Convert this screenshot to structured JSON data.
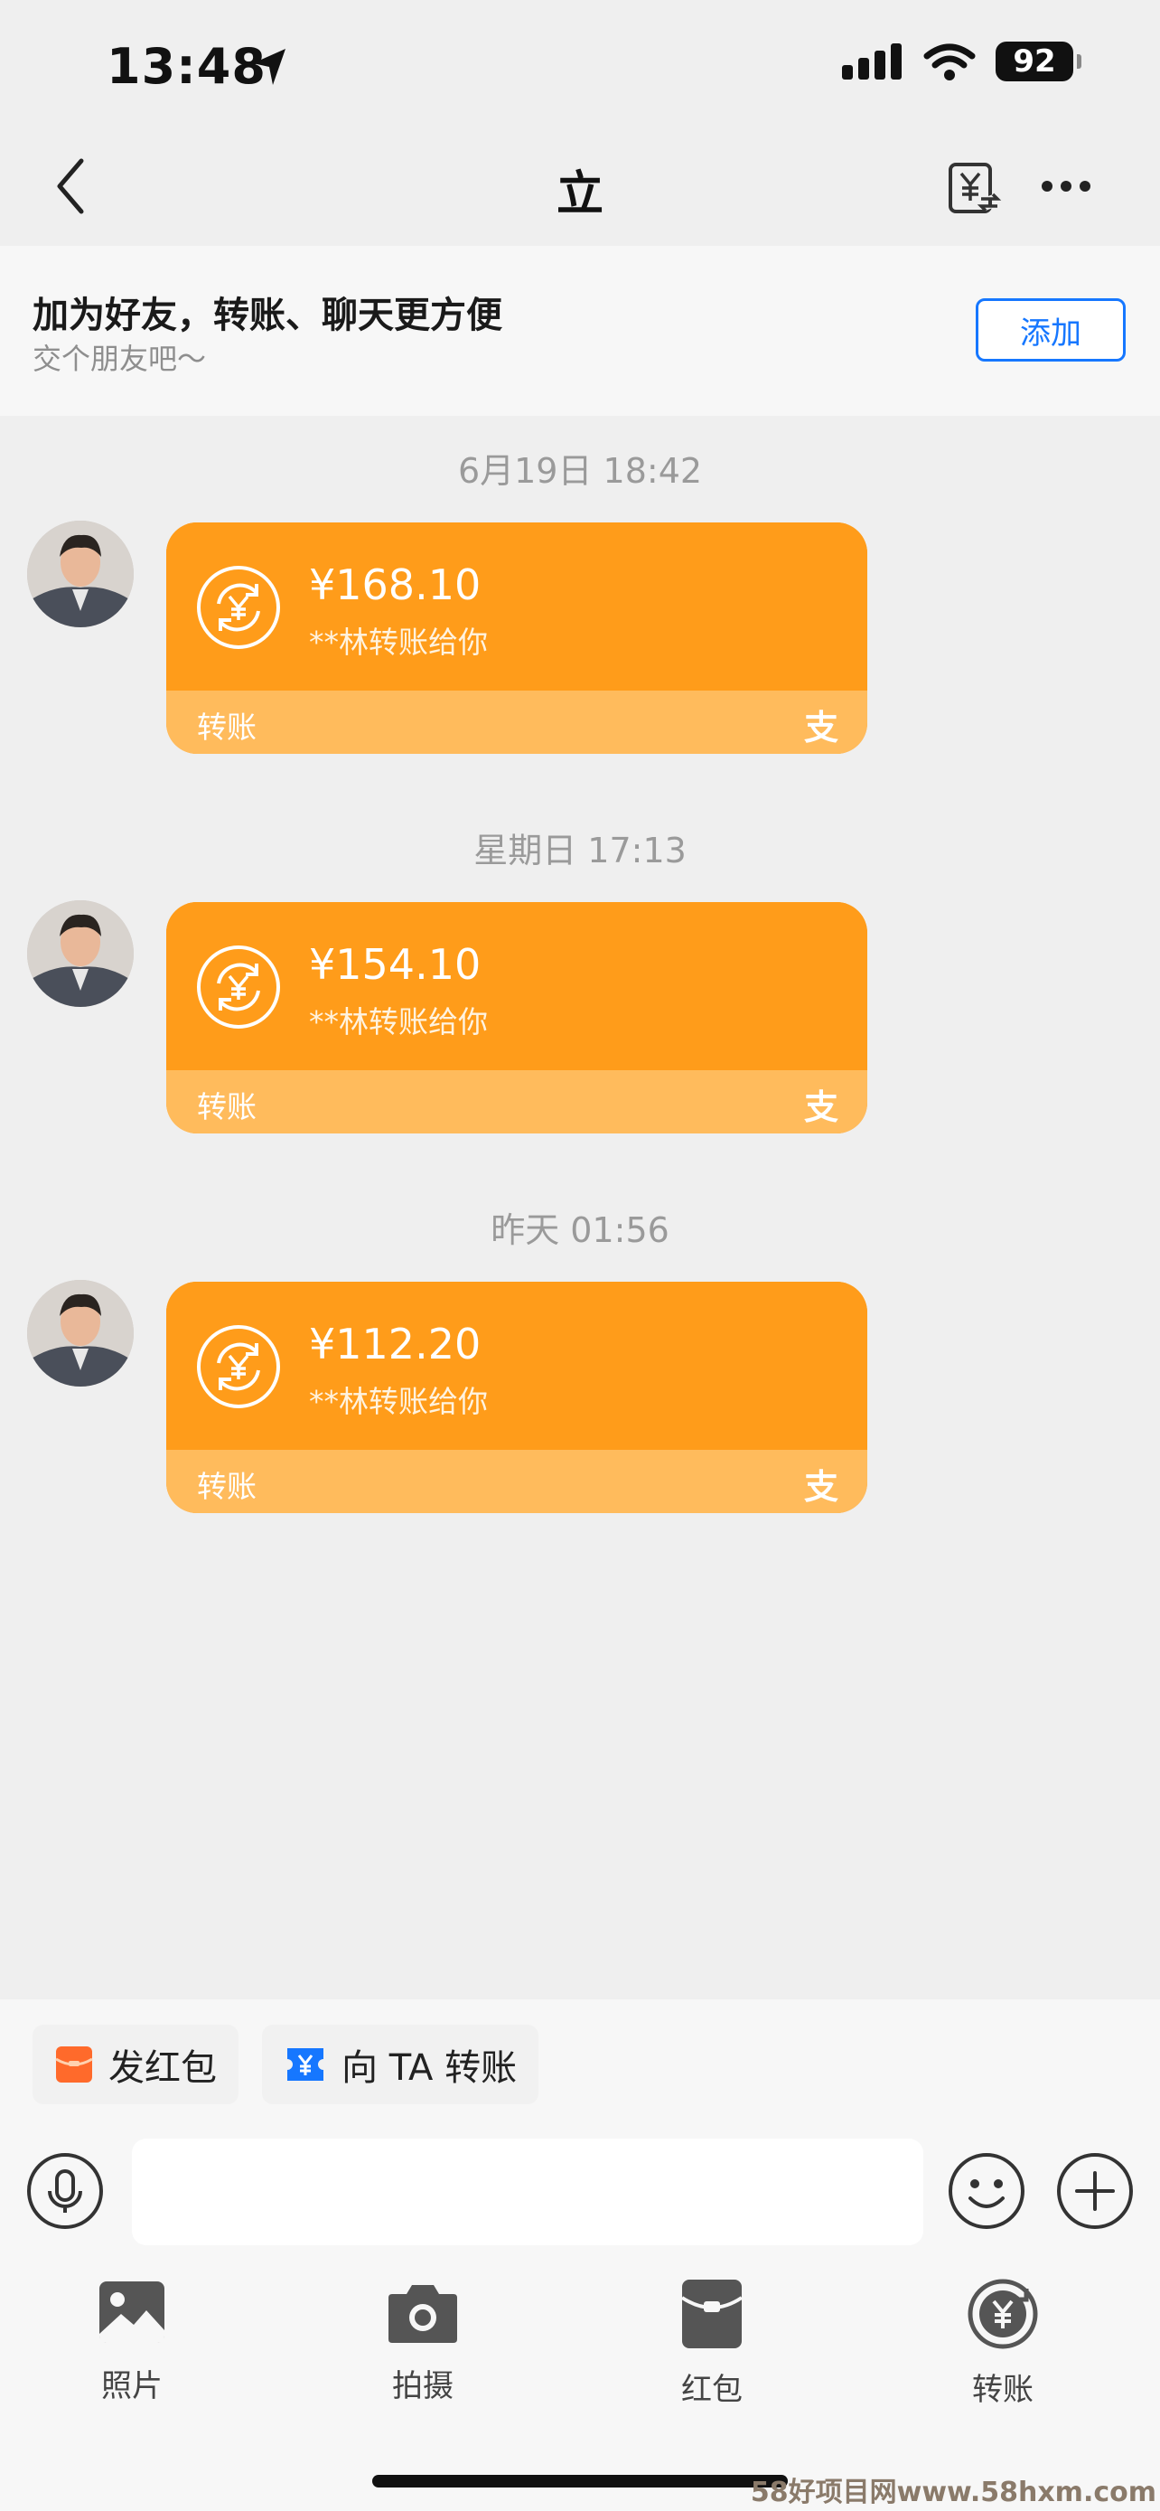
{
  "status": {
    "time": "13:48",
    "battery": "92"
  },
  "nav": {
    "title": "立"
  },
  "banner": {
    "title": "加为好友，转账、聊天更方便",
    "subtitle": "交个朋友吧～",
    "add_label": "添加"
  },
  "messages": [
    {
      "timestamp": "6月19日 18:42",
      "amount": "¥168.10",
      "desc": "**林转账给你",
      "label": "转账",
      "logo": "支"
    },
    {
      "timestamp": "星期日 17:13",
      "amount": "¥154.10",
      "desc": "**林转账给你",
      "label": "转账",
      "logo": "支"
    },
    {
      "timestamp": "昨天 01:56",
      "amount": "¥112.20",
      "desc": "**林转账给你",
      "label": "转账",
      "logo": "支"
    }
  ],
  "quick_actions": [
    {
      "label": "发红包",
      "icon": "red-envelope-icon"
    },
    {
      "label": "向 TA 转账",
      "icon": "transfer-ticket-icon"
    }
  ],
  "input": {
    "placeholder": ""
  },
  "tools": [
    {
      "label": "照片",
      "icon": "photo-icon"
    },
    {
      "label": "拍摄",
      "icon": "camera-icon"
    },
    {
      "label": "红包",
      "icon": "red-packet-icon"
    },
    {
      "label": "转账",
      "icon": "transfer-icon"
    }
  ],
  "watermark": "58好项目网www.58hxm.com",
  "colors": {
    "card": "#ff9c1a",
    "card_bottom": "#ffbb5c",
    "accent": "#1677ff"
  }
}
